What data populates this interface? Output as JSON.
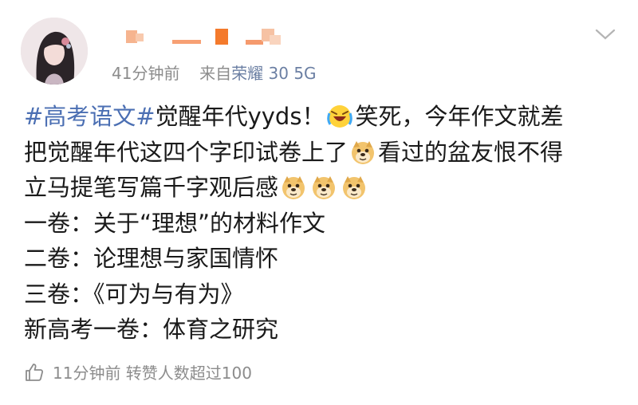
{
  "post": {
    "time": "41分钟前",
    "source_prefix": "来自",
    "source_device": "荣耀 30 5G",
    "lines": [
      {
        "tag": "#高考语文#",
        "text": "觉醒年代yyds！",
        "emoji": "laughing-crying-emoji",
        "text2": "笑死，今年作文就差"
      },
      {
        "text": "把觉醒年代这四个字印试卷上了",
        "emoji": "doge-emoji",
        "text2": "看过的盆友恨不得"
      },
      {
        "text": "立马提笔写篇千字观后感",
        "emojis": [
          "doge-emoji",
          "doge-emoji",
          "doge-emoji"
        ]
      },
      {
        "text": "一卷：关于“理想”的材料作文"
      },
      {
        "text": "二卷：论理想与家国情怀"
      },
      {
        "text": "三卷：《可为与有为》"
      },
      {
        "text": "新高考一卷：体育之研究"
      }
    ]
  },
  "footer": {
    "icon": "thumbs-up-icon",
    "text": "11分钟前 转赞人数超过100"
  },
  "colors": {
    "tag": "#4b6fb3",
    "meta": "#8c8c8c"
  }
}
